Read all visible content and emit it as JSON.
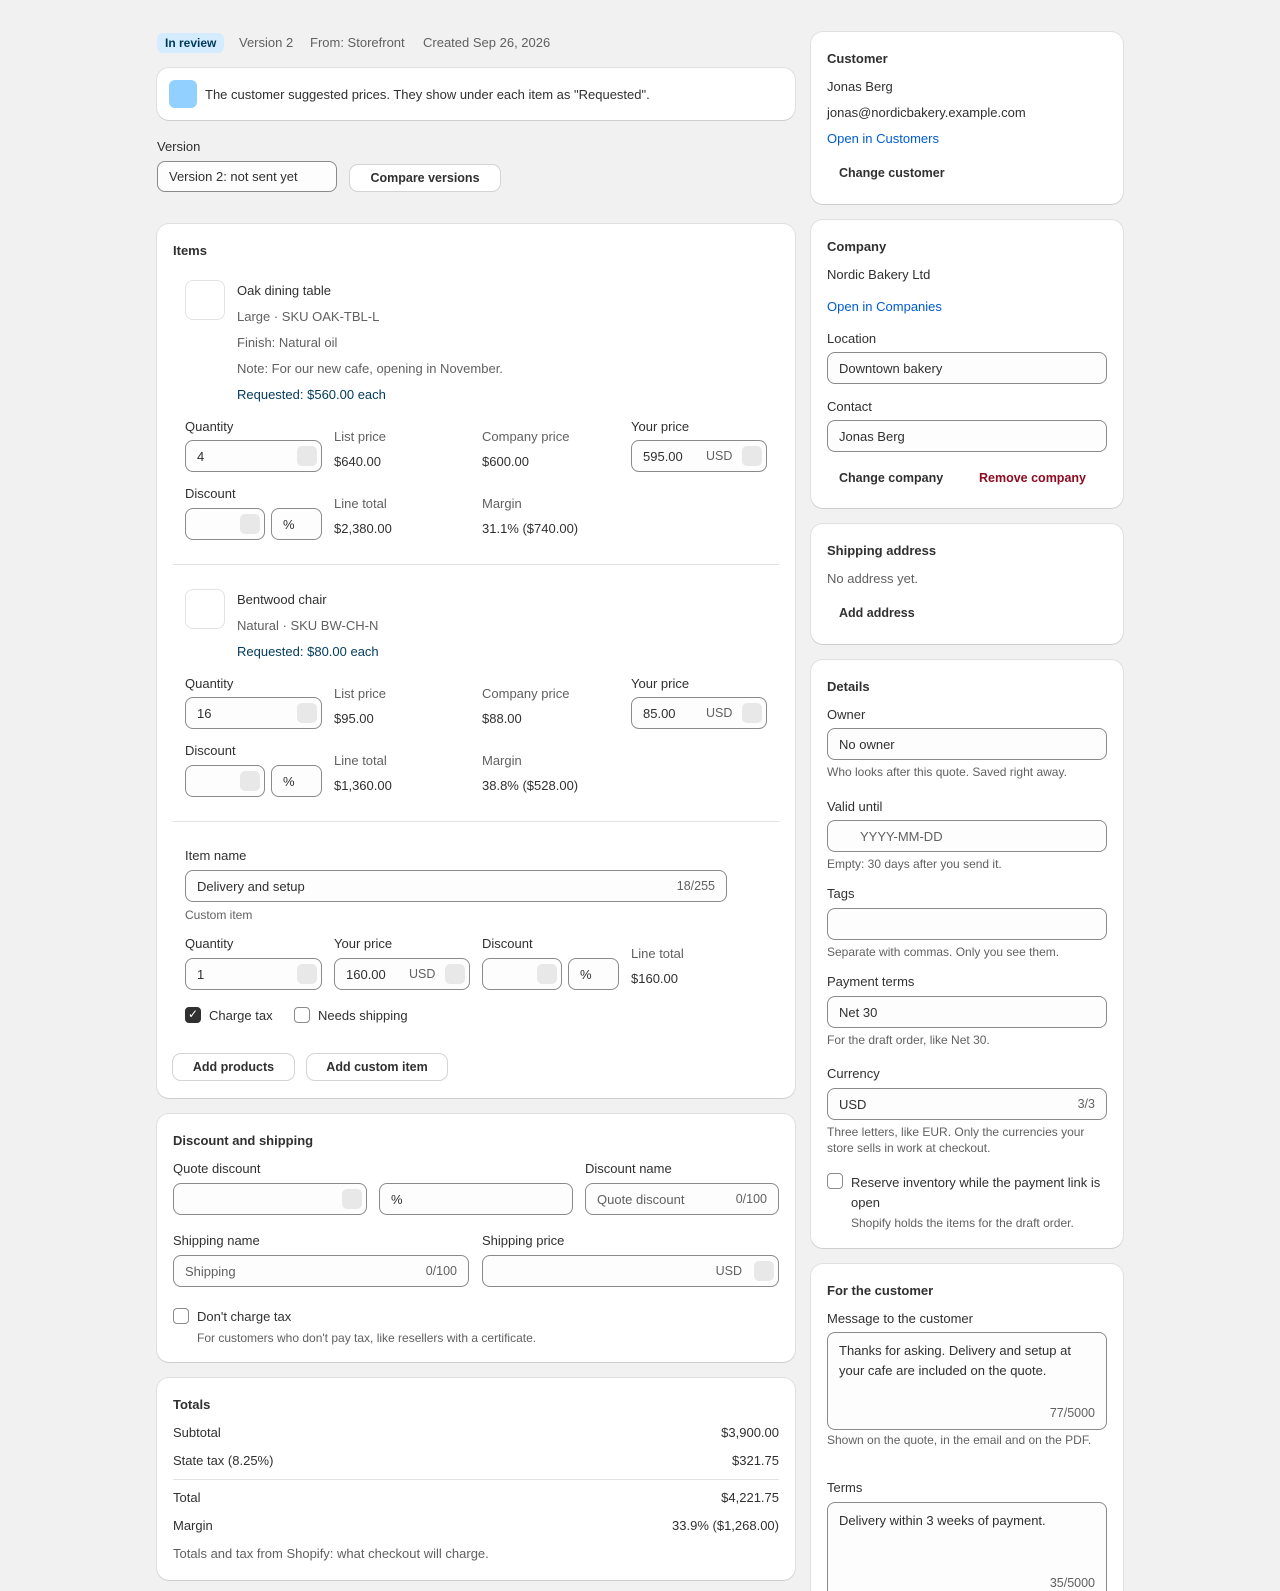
{
  "header": {
    "status_badge": "In review",
    "version": "Version 2",
    "from": "From: Storefront",
    "created": "Created Sep 26, 2026"
  },
  "banner": {
    "text": "The customer suggested prices. They show under each item as \"Requested\"."
  },
  "version_select": {
    "label": "Version",
    "value": "Version 2: not sent yet",
    "compare_button": "Compare versions"
  },
  "items": {
    "title": "Items",
    "products": [
      {
        "name": "Oak dining table",
        "variant": "Large · SKU OAK-TBL-L",
        "finish": "Finish: Natural oil",
        "note": "Note: For our new cafe, opening in November.",
        "requested": "Requested: $560.00 each",
        "quantity_label": "Quantity",
        "quantity": "4",
        "list_price_label": "List price",
        "list_price": "$640.00",
        "company_price_label": "Company price",
        "company_price": "$600.00",
        "your_price_label": "Your price",
        "your_price": "595.00",
        "currency": "USD",
        "discount_label": "Discount",
        "discount_unit": "%",
        "line_total_label": "Line total",
        "line_total": "$2,380.00",
        "margin_label": "Margin",
        "margin": "31.1% ($740.00)"
      },
      {
        "name": "Bentwood chair",
        "variant": "Natural · SKU BW-CH-N",
        "requested": "Requested: $80.00 each",
        "quantity_label": "Quantity",
        "quantity": "16",
        "list_price_label": "List price",
        "list_price": "$95.00",
        "company_price_label": "Company price",
        "company_price": "$88.00",
        "your_price_label": "Your price",
        "your_price": "85.00",
        "currency": "USD",
        "discount_label": "Discount",
        "discount_unit": "%",
        "line_total_label": "Line total",
        "line_total": "$1,360.00",
        "margin_label": "Margin",
        "margin": "38.8% ($528.00)"
      }
    ],
    "custom": {
      "name_label": "Item name",
      "name_value": "Delivery and setup",
      "name_count": "18/255",
      "custom_tag": "Custom item",
      "quantity_label": "Quantity",
      "quantity": "1",
      "your_price_label": "Your price",
      "your_price": "160.00",
      "currency": "USD",
      "discount_label": "Discount",
      "discount_unit": "%",
      "line_total_label": "Line total",
      "line_total": "$160.00",
      "charge_tax_label": "Charge tax",
      "charge_tax": true,
      "needs_shipping_label": "Needs shipping",
      "needs_shipping": false
    },
    "add_products": "Add products",
    "add_custom_item": "Add custom item"
  },
  "discount_shipping": {
    "title": "Discount and shipping",
    "quote_discount_label": "Quote discount",
    "discount_unit": "%",
    "discount_name_label": "Discount name",
    "discount_name_placeholder": "Quote discount",
    "discount_name_count": "0/100",
    "shipping_name_label": "Shipping name",
    "shipping_name_placeholder": "Shipping",
    "shipping_name_count": "0/100",
    "shipping_price_label": "Shipping price",
    "shipping_currency": "USD",
    "dont_charge_tax_label": "Don't charge tax",
    "dont_charge_tax_help": "For customers who don't pay tax, like resellers with a certificate."
  },
  "totals": {
    "title": "Totals",
    "subtotal_label": "Subtotal",
    "subtotal": "$3,900.00",
    "tax_label": "State tax (8.25%)",
    "tax": "$321.75",
    "total_label": "Total",
    "total": "$4,221.75",
    "margin_label": "Margin",
    "margin": "33.9% ($1,268.00)",
    "footnote": "Totals and tax from Shopify: what checkout will charge."
  },
  "customer": {
    "title": "Customer",
    "name": "Jonas Berg",
    "email": "jonas@nordicbakery.example.com",
    "open_link": "Open in Customers",
    "change_button": "Change customer"
  },
  "company": {
    "title": "Company",
    "name": "Nordic Bakery Ltd",
    "open_link": "Open in Companies",
    "location_label": "Location",
    "location": "Downtown bakery",
    "contact_label": "Contact",
    "contact": "Jonas Berg",
    "change_button": "Change company",
    "remove_button": "Remove company"
  },
  "shipping_address": {
    "title": "Shipping address",
    "empty": "No address yet.",
    "add_button": "Add address"
  },
  "details": {
    "title": "Details",
    "owner_label": "Owner",
    "owner": "No owner",
    "owner_help": "Who looks after this quote. Saved right away.",
    "valid_until_label": "Valid until",
    "valid_until_placeholder": "YYYY-MM-DD",
    "valid_until_help": "Empty: 30 days after you send it.",
    "tags_label": "Tags",
    "tags_help": "Separate with commas. Only you see them.",
    "payment_terms_label": "Payment terms",
    "payment_terms": "Net 30",
    "payment_terms_help": "For the draft order, like Net 30.",
    "currency_label": "Currency",
    "currency": "USD",
    "currency_count": "3/3",
    "currency_help": "Three letters, like EUR. Only the currencies your store sells in work at checkout.",
    "reserve_label": "Reserve inventory while the payment link is open",
    "reserve_help": "Shopify holds the items for the draft order."
  },
  "for_customer": {
    "title": "For the customer",
    "message_label": "Message to the customer",
    "message": "Thanks for asking. Delivery and setup at your cafe are included on the quote.",
    "message_count": "77/5000",
    "message_help": "Shown on the quote, in the email and on the PDF.",
    "terms_label": "Terms",
    "terms": "Delivery within 3 weeks of payment.",
    "terms_count": "35/5000"
  },
  "colors": {
    "badge_bg": "#d5ebff",
    "badge_text": "#003a5a",
    "link": "#005bd3",
    "critical": "#8e0b21",
    "banner_icon": "#91d0ff"
  }
}
